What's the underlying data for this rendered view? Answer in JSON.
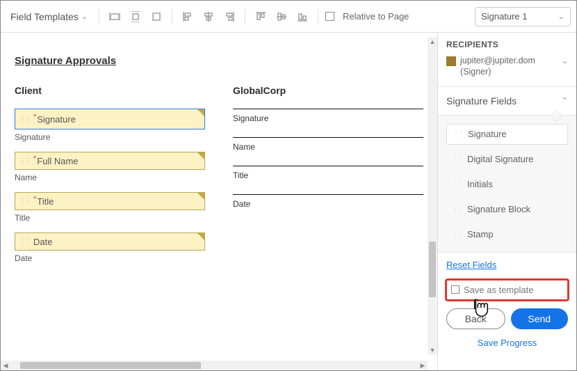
{
  "toolbar": {
    "field_templates_label": "Field Templates",
    "relative_to_page_label": "Relative to Page",
    "signer_select_value": "Signature 1"
  },
  "document": {
    "title": "Signature Approvals",
    "left_col_header": "Client",
    "right_col_header": "GlobalCorp",
    "fields": {
      "signature_label": "Signature",
      "fullname_label": "Full Name",
      "title_label": "Title",
      "date_label": "Date"
    },
    "captions": {
      "signature": "Signature",
      "name": "Name",
      "title": "Title",
      "date": "Date"
    }
  },
  "right": {
    "recipients_header": "RECIPIENTS",
    "recipient_email": "jupiter@jupiter.dom",
    "recipient_role": "(Signer)",
    "sigfields_header": "Signature Fields",
    "palette": {
      "signature": "Signature",
      "digital": "Digital Signature",
      "initials": "Initials",
      "block": "Signature Block",
      "stamp": "Stamp"
    },
    "reset_label": "Reset Fields",
    "save_template_label": "Save as template",
    "back_label": "Back",
    "send_label": "Send",
    "save_progress_label": "Save Progress"
  }
}
